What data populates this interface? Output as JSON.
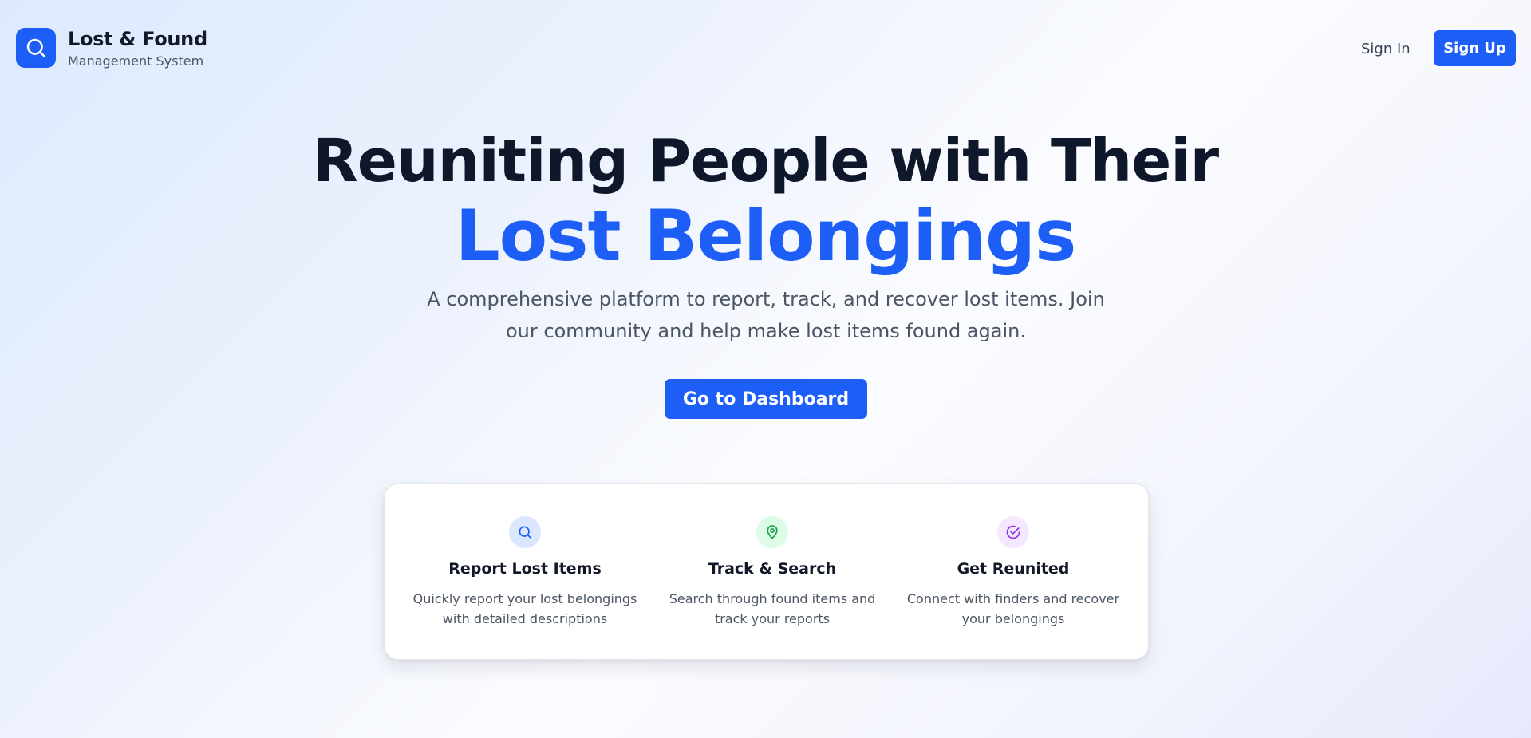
{
  "brand": {
    "title": "Lost & Found",
    "subtitle": "Management System",
    "logo_icon": "search-icon"
  },
  "nav": {
    "signin_label": "Sign In",
    "signup_label": "Sign Up"
  },
  "hero": {
    "title_line1": "Reuniting People with Their",
    "title_line2": "Lost Belongings",
    "description": "A comprehensive platform to report, track, and recover lost items. Join our community and help make lost items found again.",
    "cta_label": "Go to Dashboard"
  },
  "features": [
    {
      "icon": "search-icon",
      "title": "Report Lost Items",
      "description": "Quickly report your lost belongings with detailed descriptions"
    },
    {
      "icon": "map-pin-icon",
      "title": "Track & Search",
      "description": "Search through found items and track your reports"
    },
    {
      "icon": "check-circle-icon",
      "title": "Get Reunited",
      "description": "Connect with finders and recover your belongings"
    }
  ],
  "colors": {
    "accent": "#1c5ef6",
    "heading": "#0f172a",
    "body_text": "#4b5563",
    "feature_blue_bg": "#dbe7fe",
    "feature_green_bg": "#dcfce7",
    "feature_purple_bg": "#f3e8ff"
  }
}
